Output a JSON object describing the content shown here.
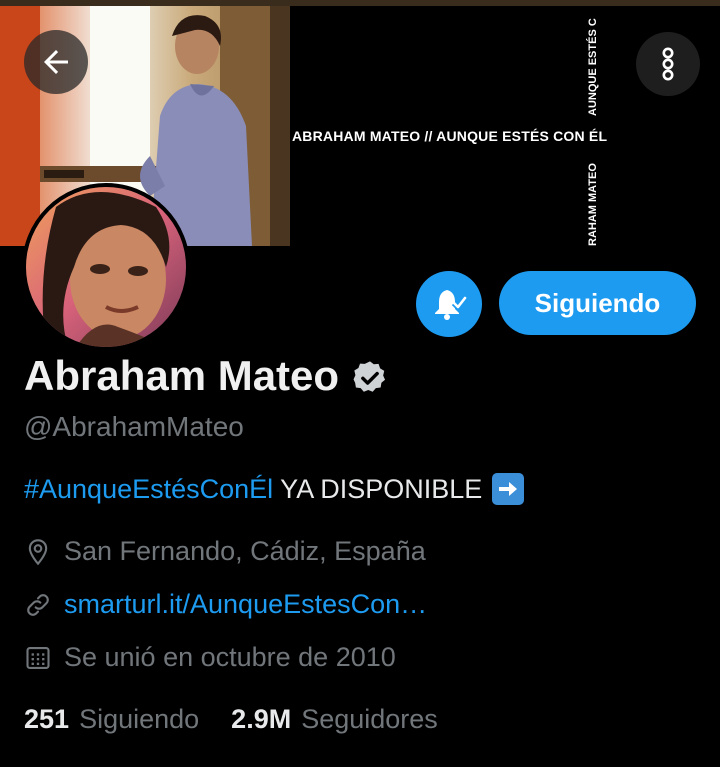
{
  "banner": {
    "title": "ABRAHAM MATEO // AUNQUE ESTÉS CON ÉL",
    "vertical_top": "AUNQUE ESTÉS C",
    "vertical_bottom": "RAHAM MATEO"
  },
  "header": {
    "back_icon": "arrow-left-icon",
    "more_icon": "more-vertical-icon"
  },
  "profile": {
    "display_name": "Abraham Mateo",
    "verified": true,
    "handle": "@AbrahamMateo",
    "bio_hashtag": "#AunqueEstésConÉl",
    "bio_text": " YA DISPONIBLE",
    "location": "San Fernando, Cádiz, España",
    "url": "smarturl.it/AunqueEstesCon…",
    "joined": "Se unió en octubre de 2010"
  },
  "actions": {
    "notify_icon": "bell-check-icon",
    "follow_label": "Siguiendo"
  },
  "stats": {
    "following_count": "251",
    "following_label": "Siguiendo",
    "followers_count": "2.9M",
    "followers_label": "Seguidores"
  },
  "colors": {
    "accent": "#1d9bf0",
    "background": "#000000",
    "muted_text": "#71767b"
  }
}
